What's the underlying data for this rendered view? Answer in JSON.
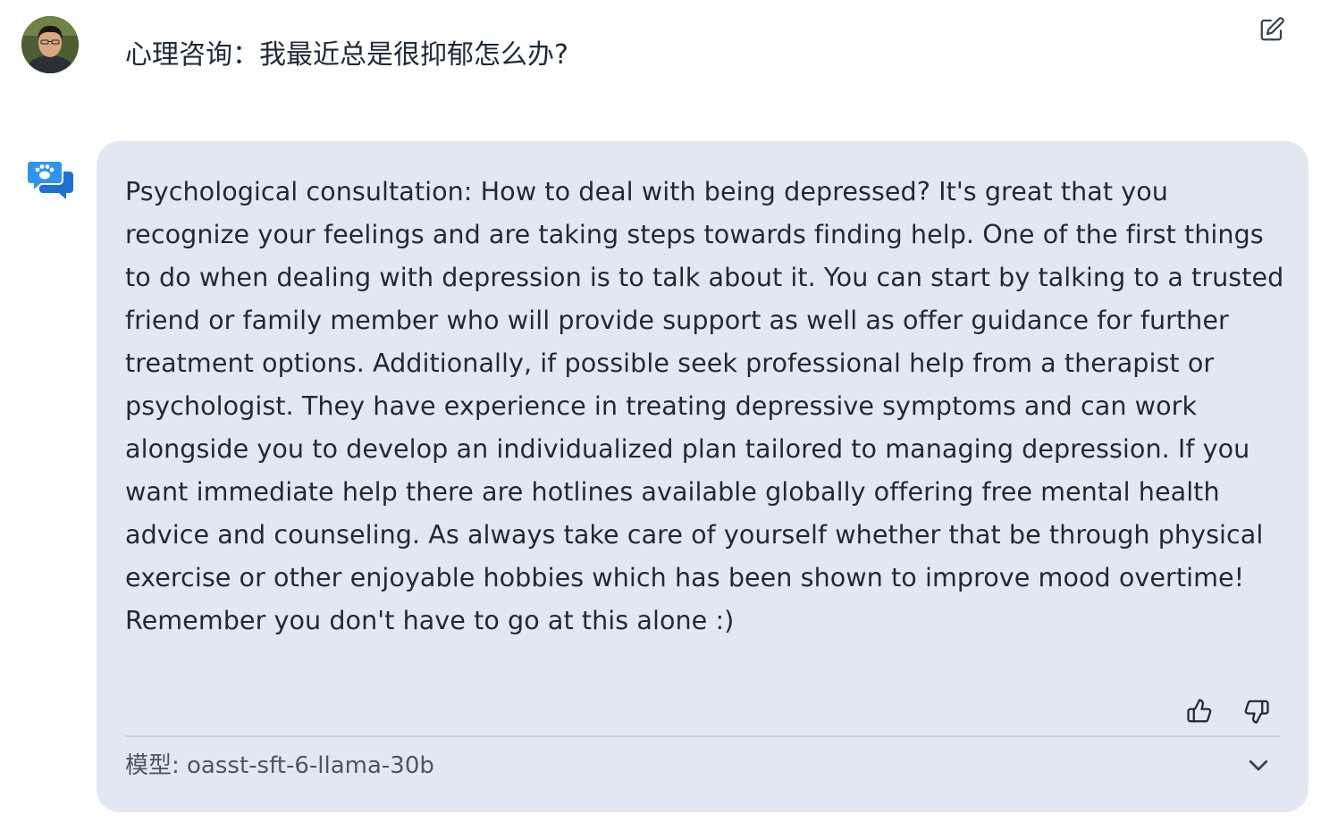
{
  "user": {
    "avatar_icon": "user-avatar-photo",
    "message": "心理咨询：我最近总是很抑郁怎么办?",
    "edit_icon": "edit-icon"
  },
  "assistant": {
    "avatar_icon": "chat-bubbles-paw-icon",
    "message": "Psychological consultation: How to deal with being depressed? It's great that you recognize your feelings and are taking steps towards finding help. One of the first things to do when dealing with depression is to talk about it. You can start by talking to a trusted friend or family member who will provide support as well as offer guidance for further treatment options. Additionally, if possible seek professional help from a therapist or psychologist. They have experience in treating depressive symptoms and can work alongside you to develop an individualized plan tailored to managing depression. If you want immediate help there are hotlines available globally offering free mental health advice and counseling. As always take care of yourself whether that be through physical exercise or other enjoyable hobbies which has been shown to improve mood overtime! Remember you don't have to go at this alone :)",
    "model_label": "模型: oasst-sft-6-llama-30b",
    "thumbs_up_icon": "thumbs-up-icon",
    "thumbs_down_icon": "thumbs-down-icon",
    "expand_icon": "chevron-down-icon"
  },
  "colors": {
    "bubble_bg": "#e2e8f2",
    "text": "#1f2937",
    "muted_text": "#4b5563",
    "divider": "#c9cfd8",
    "brand_blue": "#1d7fe0"
  }
}
